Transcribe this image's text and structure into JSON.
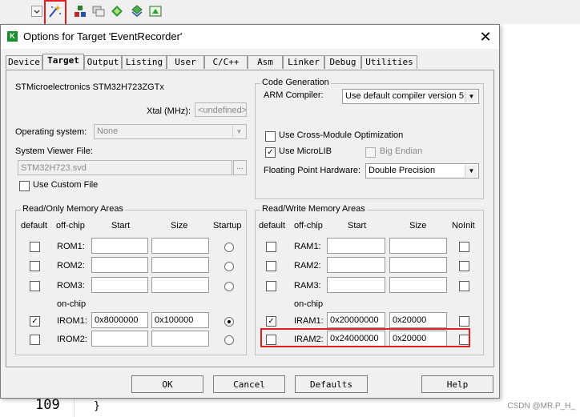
{
  "dialog": {
    "title": "Options for Target 'EventRecorder'",
    "close_glyph": "✕",
    "tabs": [
      "Device",
      "Target",
      "Output",
      "Listing",
      "User",
      "C/C++",
      "Asm",
      "Linker",
      "Debug",
      "Utilities"
    ],
    "active_tab": "Target"
  },
  "target": {
    "device_name": "STMicroelectronics STM32H723ZGTx",
    "xtal_label": "Xtal (MHz):",
    "xtal_value": "<undefined>",
    "os_label": "Operating system:",
    "os_value": "None",
    "svf_label": "System Viewer File:",
    "svf_value": "STM32H723.svd",
    "browse_label": "...",
    "custom_file_label": "Use Custom File"
  },
  "codegen": {
    "title": "Code Generation",
    "compiler_label": "ARM Compiler:",
    "compiler_value": "Use default compiler version 5",
    "cross_module_label": "Use Cross-Module Optimization",
    "microlib_label": "Use MicroLIB",
    "microlib_checked": true,
    "big_endian_label": "Big Endian",
    "fph_label": "Floating Point Hardware:",
    "fph_value": "Double Precision"
  },
  "ro_memory": {
    "title": "Read/Only Memory Areas",
    "headers": {
      "default": "default",
      "offchip": "off-chip",
      "start": "Start",
      "size": "Size",
      "startup": "Startup"
    },
    "onchip_label": "on-chip",
    "rows": [
      {
        "name": "ROM1:",
        "start": "",
        "size": "",
        "default": false,
        "startup": false
      },
      {
        "name": "ROM2:",
        "start": "",
        "size": "",
        "default": false,
        "startup": false
      },
      {
        "name": "ROM3:",
        "start": "",
        "size": "",
        "default": false,
        "startup": false
      },
      {
        "name": "IROM1:",
        "start": "0x8000000",
        "size": "0x100000",
        "default": true,
        "startup": true
      },
      {
        "name": "IROM2:",
        "start": "",
        "size": "",
        "default": false,
        "startup": false
      }
    ]
  },
  "rw_memory": {
    "title": "Read/Write Memory Areas",
    "headers": {
      "default": "default",
      "offchip": "off-chip",
      "start": "Start",
      "size": "Size",
      "noinit": "NoInit"
    },
    "onchip_label": "on-chip",
    "rows": [
      {
        "name": "RAM1:",
        "start": "",
        "size": "",
        "default": false,
        "noinit": false
      },
      {
        "name": "RAM2:",
        "start": "",
        "size": "",
        "default": false,
        "noinit": false
      },
      {
        "name": "RAM3:",
        "start": "",
        "size": "",
        "default": false,
        "noinit": false
      },
      {
        "name": "IRAM1:",
        "start": "0x20000000",
        "size": "0x20000",
        "default": true,
        "noinit": false
      },
      {
        "name": "IRAM2:",
        "start": "0x24000000",
        "size": "0x20000",
        "default": false,
        "noinit": false
      }
    ]
  },
  "buttons": {
    "ok": "OK",
    "cancel": "Cancel",
    "defaults": "Defaults",
    "help": "Help"
  },
  "editor": {
    "line_number": "109",
    "code_line": "}"
  },
  "toolbar": {
    "icons": [
      "dropdown-arrow-icon",
      "magic-wand-icon",
      "manage-project-items-icon",
      "pack-installer-icon",
      "select-packs-icon",
      "manage-runtime-icon",
      "event-recorder-icon"
    ]
  },
  "watermark": "CSDN @MR.P_H_",
  "colors": {
    "highlight_red": "#e02020"
  }
}
